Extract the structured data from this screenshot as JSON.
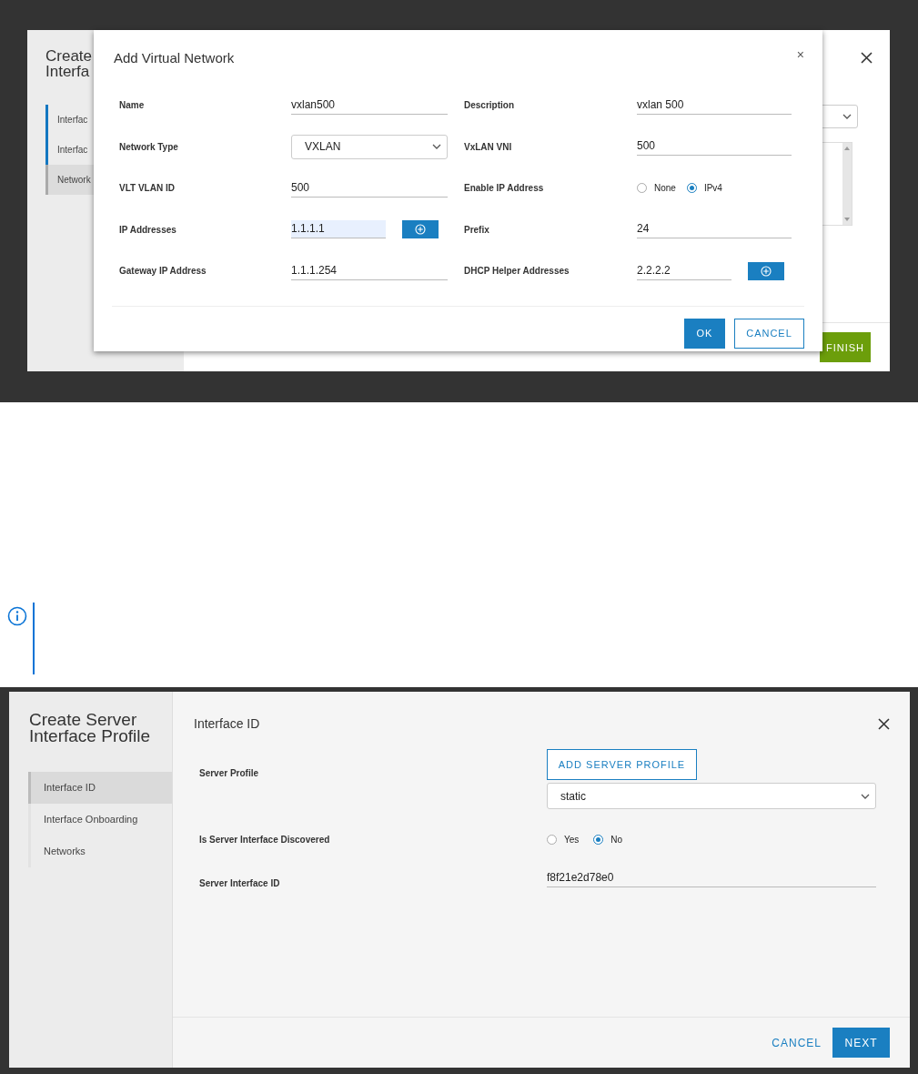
{
  "background_wizard": {
    "title_lines": [
      "Create",
      "Interfa"
    ],
    "steps": [
      {
        "label": "Interfac",
        "selected": false,
        "completed": true
      },
      {
        "label": "Interfac",
        "selected": false,
        "completed": true
      },
      {
        "label": "Network",
        "selected": true,
        "completed": false
      }
    ],
    "finish_button": "FINISH"
  },
  "dialog": {
    "title": "Add Virtual Network",
    "close": "×",
    "rows": [
      {
        "left": {
          "kind": "text",
          "label": "Name",
          "value": "vxlan500",
          "highlighted": false
        },
        "right": {
          "kind": "text",
          "label": "Description",
          "value": "vxlan 500",
          "highlighted": false
        }
      },
      {
        "left": {
          "kind": "select",
          "label": "Network Type",
          "value": "VXLAN"
        },
        "right": {
          "kind": "text",
          "label": "VxLAN VNI",
          "value": "500",
          "highlighted": false
        }
      },
      {
        "left": {
          "kind": "text",
          "label": "VLT VLAN ID",
          "value": "500",
          "highlighted": false
        },
        "right": {
          "kind": "radio",
          "label": "Enable IP Address",
          "options": [
            {
              "label": "None",
              "selected": false
            },
            {
              "label": "IPv4",
              "selected": true
            }
          ]
        }
      },
      {
        "left": {
          "kind": "add",
          "label": "IP Addresses",
          "value": "1.1.1.1",
          "highlighted": true
        },
        "right": {
          "kind": "text",
          "label": "Prefix",
          "value": "24",
          "highlighted": false
        }
      },
      {
        "left": {
          "kind": "text",
          "label": "Gateway IP Address",
          "value": "1.1.1.254",
          "highlighted": false
        },
        "right": {
          "kind": "add",
          "label": "DHCP Helper Addresses",
          "value": "2.2.2.2",
          "highlighted": false
        }
      }
    ],
    "buttons": [
      {
        "label": "OK",
        "primary": true
      },
      {
        "label": "CANCEL",
        "primary": false
      }
    ]
  },
  "wizard": {
    "title": "Create Server Interface Profile",
    "steps": [
      {
        "label": "Interface ID",
        "selected": true
      },
      {
        "label": "Interface Onboarding",
        "selected": false
      },
      {
        "label": "Networks",
        "selected": false
      }
    ],
    "heading": "Interface ID",
    "server_profile": {
      "label": "Server Profile",
      "add_button": "ADD SERVER PROFILE",
      "value": "static"
    },
    "discovered": {
      "label": "Is Server Interface Discovered",
      "options": [
        {
          "label": "Yes",
          "selected": false
        },
        {
          "label": "No",
          "selected": true
        }
      ]
    },
    "interface_id": {
      "label": "Server Interface ID",
      "value": "f8f21e2d78e0"
    },
    "buttons": [
      {
        "label": "CANCEL",
        "primary": false
      },
      {
        "label": "NEXT",
        "primary": true
      }
    ]
  }
}
